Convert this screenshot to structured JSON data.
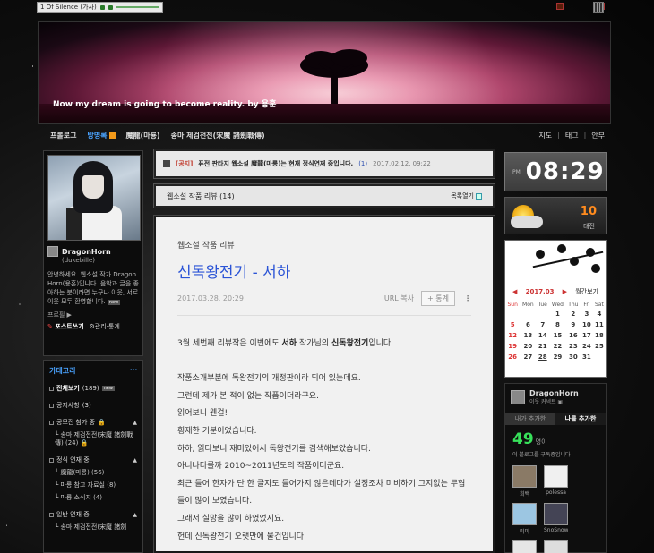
{
  "player": {
    "title": "1 Of Silence (가사)"
  },
  "banner": {
    "tagline": "Now my dream is going to become reality. by 용훈"
  },
  "menu": {
    "items": [
      "프롤로그",
      "방명록",
      "魔龍(마룡)",
      "송마 제검전전(宋魔 諸劍戰傳)"
    ],
    "right": [
      "지도",
      "태그",
      "안부"
    ]
  },
  "profile": {
    "name": "DragonHorn",
    "id": "(dukebille)",
    "desc": "안녕하세요. 웹소설 작가 DragonHorn(용혼)입니다. 음악과 글을 좋아하는 분이라면 누구나 이웃, 서로이웃 모두 환영합니다.",
    "desc_tag": "new",
    "profile_link": "프로필 ▶",
    "write": "포스트쓰기",
    "manage": "관리·통계"
  },
  "category": {
    "title": "카테고리",
    "items": [
      {
        "label": "전체보기",
        "count": "(189)",
        "badge": "new"
      },
      {
        "label": "공지사항",
        "count": "(3)"
      },
      {
        "label": "공모전 참가 중",
        "count": ""
      },
      {
        "label": "송마 제검전전(宋魔 諸劍戰傳)",
        "count": "(24)"
      },
      {
        "label": "정식 연재 중",
        "count": ""
      },
      {
        "label": "魔龍(마룡)",
        "count": "(56)"
      },
      {
        "label": "마룡 참고 자료실",
        "count": "(8)"
      },
      {
        "label": "마룡 소식지",
        "count": "(4)"
      },
      {
        "label": "일반 연재 중",
        "count": ""
      },
      {
        "label": "송마 제검전전(宋魔 諸劍",
        "count": ""
      }
    ]
  },
  "notice": {
    "tag": "[공지]",
    "text": "퓨전 판타지 웹소설 魔龍(마룡)는 현재 정식연재 중입니다.",
    "count": "(1)",
    "date": "2017.02.12. 09:22"
  },
  "subbar": {
    "title": "웹소설 작품 리뷰 (14)",
    "list_btn": "목록열기"
  },
  "post": {
    "category": "웹소설 작품 리뷰",
    "title": "신독왕전기 - 서하",
    "date": "2017.03.28. 20:29",
    "url_copy": "URL 복사",
    "stat": "+ 통계",
    "paragraphs": [
      "3월 세번째 리뷰작은 이번에도 서하 작가님의 신독왕전기입니다.",
      "",
      "작품소개부분에 독왕전기의 개정판이라 되어 있는데요.",
      "그런데 제가 본 적이 없는 작품이더라구요.",
      "읽어보니 웬걸!",
      "횡재한 기분이었습니다.",
      "하하, 읽다보니 재미있어서 독왕전기를 검색해보았습니다.",
      "아니나다를까 2010~2011년도의 작품이더군요.",
      "최근 들어 한자가 단 한 글자도 들어가지 않은데다가 설정조차 미비하기 그지없는 무협들이 많이 보였습니다.",
      "그래서 실망을 많이 하였었지요.",
      "헌데 신독왕전기 오랫만에 물건입니다."
    ],
    "bold_author": "서하",
    "bold_work": "신독왕전기"
  },
  "clock": {
    "ampm": "PM",
    "time": "08:29"
  },
  "weather": {
    "temp": "10",
    "loc": "대전"
  },
  "calendar": {
    "month": "2017.03",
    "popular": "월간보기",
    "weekdays": [
      "Sun",
      "Mon",
      "Tue",
      "Wed",
      "Thu",
      "Fri",
      "Sat"
    ],
    "weeks": [
      [
        "",
        "",
        "",
        "1",
        "2",
        "3",
        "4"
      ],
      [
        "5",
        "6",
        "7",
        "8",
        "9",
        "10",
        "11"
      ],
      [
        "12",
        "13",
        "14",
        "15",
        "16",
        "17",
        "18"
      ],
      [
        "19",
        "20",
        "21",
        "22",
        "23",
        "24",
        "25"
      ],
      [
        "26",
        "27",
        "28",
        "29",
        "30",
        "31",
        ""
      ]
    ],
    "today": "28"
  },
  "follow": {
    "name": "DragonHorn",
    "sub": "이웃 커넥트 ▣",
    "tab_off": "내가 추가한",
    "tab_on": "나를 추가한",
    "count": "49",
    "count_unit": "명이",
    "desc": "이 블로그를 구독중입니다",
    "faces": [
      "희백",
      "polessa",
      "미미",
      "SnoSnow",
      "호호",
      "zelu531"
    ]
  }
}
